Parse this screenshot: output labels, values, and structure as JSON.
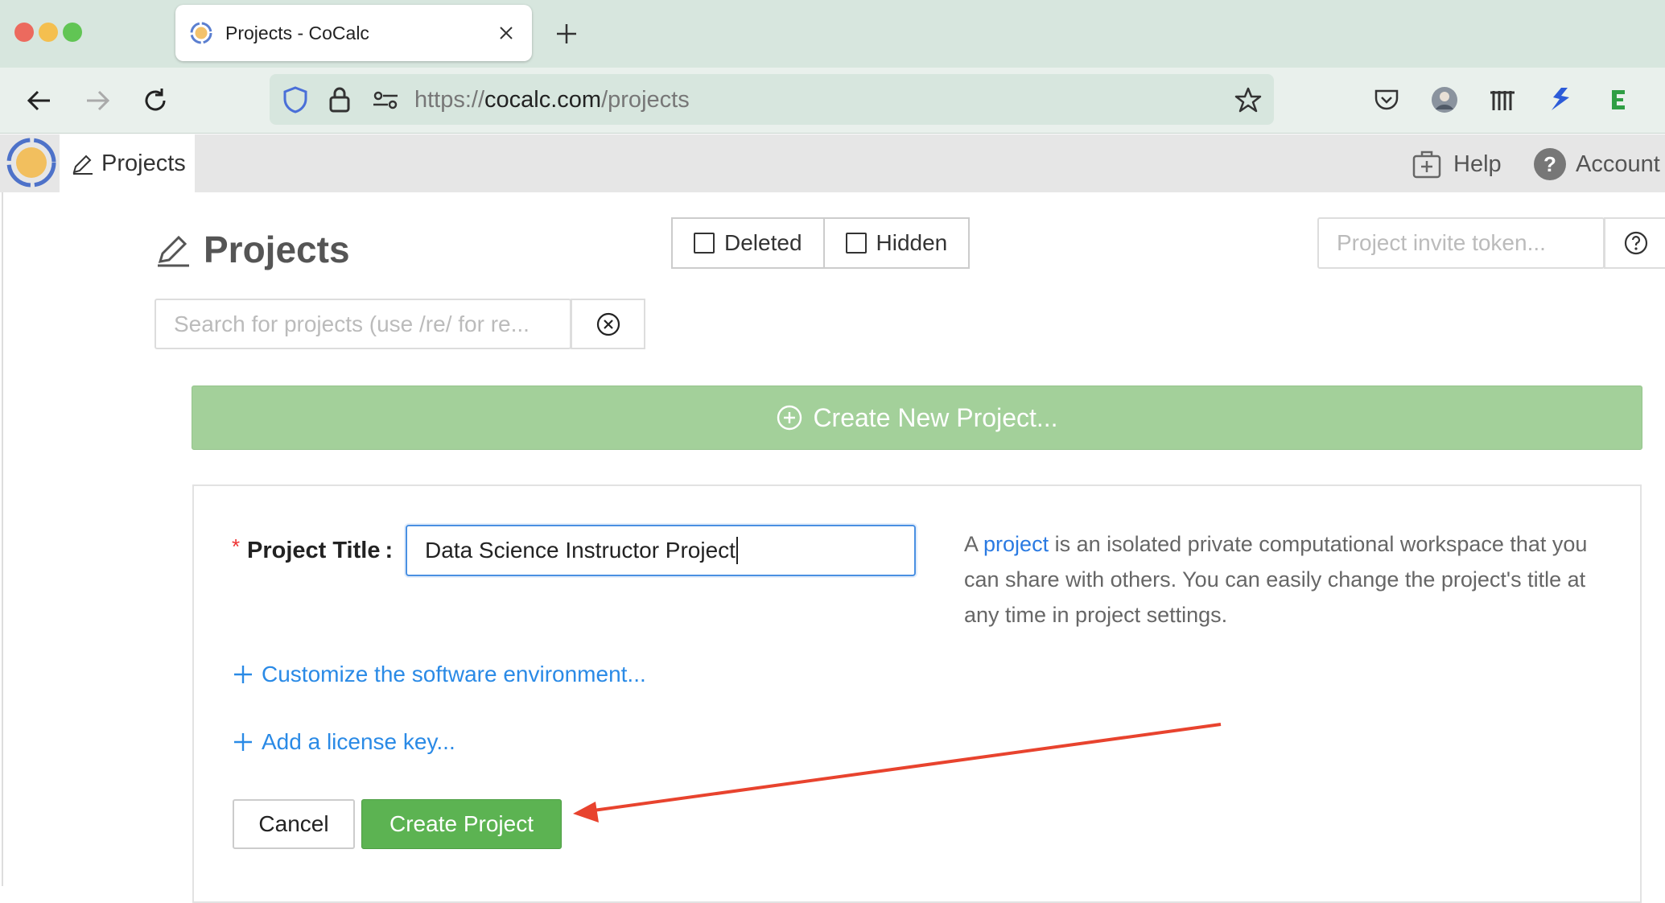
{
  "browser": {
    "tab_title": "Projects - CoCalc",
    "url_prefix": "https://",
    "url_host": "cocalc.com",
    "url_path": "/projects"
  },
  "app": {
    "nav_tab_label": "Projects",
    "help_label": "Help",
    "account_label": "Account",
    "account_icon_text": "?"
  },
  "page": {
    "title": "Projects",
    "filters": {
      "deleted": "Deleted",
      "hidden": "Hidden"
    },
    "token_placeholder": "Project invite token...",
    "search_placeholder": "Search for projects (use /re/ for re..."
  },
  "create": {
    "new_project_button": "Create New Project...",
    "required_mark": "*",
    "title_label": "Project Title",
    "title_colon": ":",
    "title_value": "Data Science Instructor Project",
    "description_prefix": "A ",
    "description_link": "project",
    "description_rest": " is an isolated private computational workspace that you can share with others. You can easily change the project's title at any time in project settings.",
    "customize_link": "Customize the software environment...",
    "license_link": "Add a license key...",
    "cancel_label": "Cancel",
    "create_label": "Create Project"
  },
  "colors": {
    "primary_green": "#5cb352",
    "light_green": "#a3d09a",
    "link_blue": "#2a8ae6",
    "annotation_arrow": "#e8432e"
  }
}
